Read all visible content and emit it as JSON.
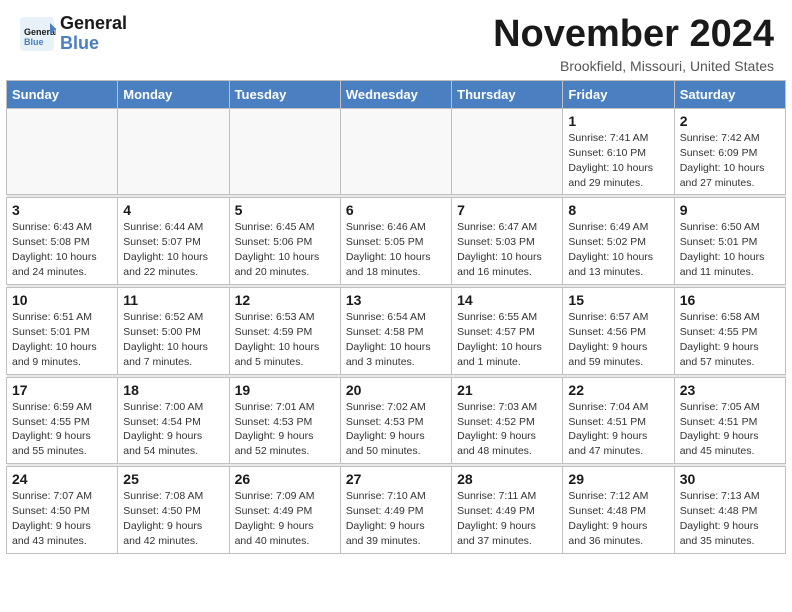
{
  "header": {
    "logo_line1": "General",
    "logo_line2": "Blue",
    "month_title": "November 2024",
    "subtitle": "Brookfield, Missouri, United States"
  },
  "weekdays": [
    "Sunday",
    "Monday",
    "Tuesday",
    "Wednesday",
    "Thursday",
    "Friday",
    "Saturday"
  ],
  "weeks": [
    [
      {
        "day": "",
        "info": ""
      },
      {
        "day": "",
        "info": ""
      },
      {
        "day": "",
        "info": ""
      },
      {
        "day": "",
        "info": ""
      },
      {
        "day": "",
        "info": ""
      },
      {
        "day": "1",
        "info": "Sunrise: 7:41 AM\nSunset: 6:10 PM\nDaylight: 10 hours\nand 29 minutes."
      },
      {
        "day": "2",
        "info": "Sunrise: 7:42 AM\nSunset: 6:09 PM\nDaylight: 10 hours\nand 27 minutes."
      }
    ],
    [
      {
        "day": "3",
        "info": "Sunrise: 6:43 AM\nSunset: 5:08 PM\nDaylight: 10 hours\nand 24 minutes."
      },
      {
        "day": "4",
        "info": "Sunrise: 6:44 AM\nSunset: 5:07 PM\nDaylight: 10 hours\nand 22 minutes."
      },
      {
        "day": "5",
        "info": "Sunrise: 6:45 AM\nSunset: 5:06 PM\nDaylight: 10 hours\nand 20 minutes."
      },
      {
        "day": "6",
        "info": "Sunrise: 6:46 AM\nSunset: 5:05 PM\nDaylight: 10 hours\nand 18 minutes."
      },
      {
        "day": "7",
        "info": "Sunrise: 6:47 AM\nSunset: 5:03 PM\nDaylight: 10 hours\nand 16 minutes."
      },
      {
        "day": "8",
        "info": "Sunrise: 6:49 AM\nSunset: 5:02 PM\nDaylight: 10 hours\nand 13 minutes."
      },
      {
        "day": "9",
        "info": "Sunrise: 6:50 AM\nSunset: 5:01 PM\nDaylight: 10 hours\nand 11 minutes."
      }
    ],
    [
      {
        "day": "10",
        "info": "Sunrise: 6:51 AM\nSunset: 5:01 PM\nDaylight: 10 hours\nand 9 minutes."
      },
      {
        "day": "11",
        "info": "Sunrise: 6:52 AM\nSunset: 5:00 PM\nDaylight: 10 hours\nand 7 minutes."
      },
      {
        "day": "12",
        "info": "Sunrise: 6:53 AM\nSunset: 4:59 PM\nDaylight: 10 hours\nand 5 minutes."
      },
      {
        "day": "13",
        "info": "Sunrise: 6:54 AM\nSunset: 4:58 PM\nDaylight: 10 hours\nand 3 minutes."
      },
      {
        "day": "14",
        "info": "Sunrise: 6:55 AM\nSunset: 4:57 PM\nDaylight: 10 hours\nand 1 minute."
      },
      {
        "day": "15",
        "info": "Sunrise: 6:57 AM\nSunset: 4:56 PM\nDaylight: 9 hours\nand 59 minutes."
      },
      {
        "day": "16",
        "info": "Sunrise: 6:58 AM\nSunset: 4:55 PM\nDaylight: 9 hours\nand 57 minutes."
      }
    ],
    [
      {
        "day": "17",
        "info": "Sunrise: 6:59 AM\nSunset: 4:55 PM\nDaylight: 9 hours\nand 55 minutes."
      },
      {
        "day": "18",
        "info": "Sunrise: 7:00 AM\nSunset: 4:54 PM\nDaylight: 9 hours\nand 54 minutes."
      },
      {
        "day": "19",
        "info": "Sunrise: 7:01 AM\nSunset: 4:53 PM\nDaylight: 9 hours\nand 52 minutes."
      },
      {
        "day": "20",
        "info": "Sunrise: 7:02 AM\nSunset: 4:53 PM\nDaylight: 9 hours\nand 50 minutes."
      },
      {
        "day": "21",
        "info": "Sunrise: 7:03 AM\nSunset: 4:52 PM\nDaylight: 9 hours\nand 48 minutes."
      },
      {
        "day": "22",
        "info": "Sunrise: 7:04 AM\nSunset: 4:51 PM\nDaylight: 9 hours\nand 47 minutes."
      },
      {
        "day": "23",
        "info": "Sunrise: 7:05 AM\nSunset: 4:51 PM\nDaylight: 9 hours\nand 45 minutes."
      }
    ],
    [
      {
        "day": "24",
        "info": "Sunrise: 7:07 AM\nSunset: 4:50 PM\nDaylight: 9 hours\nand 43 minutes."
      },
      {
        "day": "25",
        "info": "Sunrise: 7:08 AM\nSunset: 4:50 PM\nDaylight: 9 hours\nand 42 minutes."
      },
      {
        "day": "26",
        "info": "Sunrise: 7:09 AM\nSunset: 4:49 PM\nDaylight: 9 hours\nand 40 minutes."
      },
      {
        "day": "27",
        "info": "Sunrise: 7:10 AM\nSunset: 4:49 PM\nDaylight: 9 hours\nand 39 minutes."
      },
      {
        "day": "28",
        "info": "Sunrise: 7:11 AM\nSunset: 4:49 PM\nDaylight: 9 hours\nand 37 minutes."
      },
      {
        "day": "29",
        "info": "Sunrise: 7:12 AM\nSunset: 4:48 PM\nDaylight: 9 hours\nand 36 minutes."
      },
      {
        "day": "30",
        "info": "Sunrise: 7:13 AM\nSunset: 4:48 PM\nDaylight: 9 hours\nand 35 minutes."
      }
    ]
  ]
}
